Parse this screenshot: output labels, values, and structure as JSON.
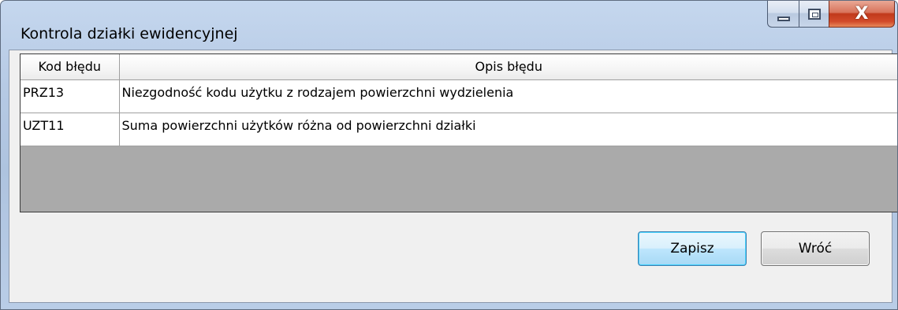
{
  "window": {
    "title": "Kontrola działki ewidencyjnej",
    "controls": {
      "minimize": "minimize-icon",
      "maximize": "maximize-icon",
      "close": "close-icon",
      "close_glyph": "X"
    }
  },
  "grid": {
    "columns": [
      "Kod błędu",
      "Opis błędu"
    ],
    "rows": [
      {
        "code": "PRZ13",
        "description": "Niezgodność kodu użytku z rodzajem powierzchni wydzielenia"
      },
      {
        "code": "UZT11",
        "description": "Suma powierzchni użytków różna od powierzchni działki"
      }
    ]
  },
  "buttons": {
    "save": "Zapisz",
    "back": "Wróć"
  },
  "colors": {
    "title_bar": "#b5c9e4",
    "close_button": "#c1391b",
    "default_button_border": "#3c7fb1"
  }
}
